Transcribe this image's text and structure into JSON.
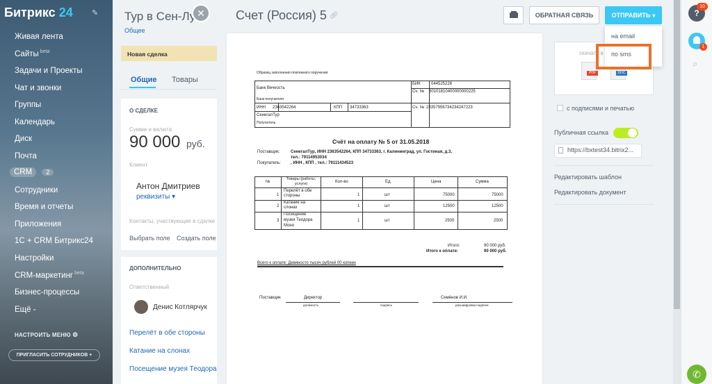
{
  "sidebar": {
    "logo_main": "Битрикс",
    "logo_num": "24",
    "items": [
      {
        "label": "Живая лента"
      },
      {
        "label": "Сайты",
        "badge": "beta"
      },
      {
        "label": "Задачи и Проекты"
      },
      {
        "label": "Чат и звонки"
      },
      {
        "label": "Группы"
      },
      {
        "label": "Календарь"
      },
      {
        "label": "Диск"
      },
      {
        "label": "Почта"
      },
      {
        "label": "CRM",
        "count": "2"
      },
      {
        "label": "Сотрудники"
      },
      {
        "label": "Время и отчеты"
      },
      {
        "label": "Приложения"
      },
      {
        "label": "1С + CRM Битрикс24"
      },
      {
        "label": "Настройки"
      },
      {
        "label": "CRM-маркетинг",
        "badge": "beta"
      },
      {
        "label": "Бизнес-процессы"
      },
      {
        "label": "Ещё -"
      }
    ],
    "menu_settings": "НАСТРОИТЬ МЕНЮ",
    "invite": "ПРИГЛАСИТЬ СОТРУДНИКОВ"
  },
  "deal": {
    "title": "Тур в Сен-Лу",
    "subtitle": "Общее",
    "stage": "Новая сделка",
    "tabs": [
      "Общие",
      "Товары"
    ],
    "section_about": "О СДЕЛКЕ",
    "amount_label": "Сумма и валюта",
    "amount": "90 000",
    "currency": "руб.",
    "client_label": "Клиент",
    "contact": "Антон Дмитриев",
    "requisites": "реквизиты",
    "contacts_note": "Контакты, участвующие в сделке",
    "select_field": "Выбрать поле",
    "create_field": "Создать поле",
    "section_more": "ДОПОЛНИТЕЛЬНО",
    "responsible_label": "Ответственный",
    "responsible": "Денис Котлярчук",
    "products": [
      "Перелёт в обе стороны",
      "Катание на слонах",
      "Посещение музея Теодора М"
    ]
  },
  "panel": {
    "title": "Счет (Россия) 5",
    "feedback": "ОБРАТНАЯ СВЯЗЬ",
    "send": "ОТПРАВИТЬ",
    "dropdown": [
      "на email",
      "по sms"
    ]
  },
  "document": {
    "sample": "Образец заполнения платежного поручения",
    "bank_name": "Банк Вечность",
    "bank_recipient": "Банк получателя",
    "bik_label": "БИК",
    "bik": "044525226",
    "account_label": "Сч. №",
    "account1": "30101810400000000225",
    "inn_label": "ИНН",
    "inn": "2363542264",
    "kpp_label": "КПП",
    "kpp": "34733363",
    "account2": "23357956734234247223",
    "company": "СенегалТур",
    "recipient": "Получатель",
    "heading": "Счёт на оплату № 5 от 31.05.2018",
    "supplier_label": "Поставщик:",
    "supplier_l1": "СенегалТур, ИНН 2363542264, КПП 34733363, г. Калининград, ул. Гостиная, д.3,",
    "supplier_l2": "тел.: 79114953034",
    "buyer_label": "Покупатель:",
    "buyer": ", ИНН , КПП , тел.: 79111434523",
    "table_headers": [
      "№",
      "Товары (работы, услуги)",
      "Кол-во",
      "Ед.",
      "Цена",
      "Сумма"
    ],
    "rows": [
      {
        "n": "1",
        "name_l1": "Перелёт в обе",
        "name_l2": "стороны",
        "name_l3": "",
        "qty": "1",
        "unit": "шт",
        "price": "75000",
        "sum": "75000"
      },
      {
        "n": "2",
        "name_l1": "Катание на",
        "name_l2": "слонах",
        "name_l3": "",
        "qty": "1",
        "unit": "шт",
        "price": "12500",
        "sum": "12500"
      },
      {
        "n": "3",
        "name_l1": "Посещение",
        "name_l2": "музея Теодора",
        "name_l3": "Моно",
        "qty": "1",
        "unit": "шт",
        "price": "2500",
        "sum": "2500"
      }
    ],
    "total_label": "Итого:",
    "total": "90 000 руб.",
    "total_pay_label": "Итого к оплате:",
    "total_pay": "90 000 руб.",
    "total_words": "Всего к оплате: Девяносто тысяч рублей 00 копеек",
    "sign_supplier": "Поставщик",
    "sign_position": "Директор",
    "sign_name": "Семёнов И.И.",
    "sign_pos_label": "должность",
    "sign_sig_label": "подпись",
    "sign_dec_label": "расшифровка подписи"
  },
  "right_column": {
    "download": "скачать в",
    "pdf": "PDF",
    "doc": "DOC",
    "signatures": "с подписями и печатью",
    "public_link": "Публичная ссылка",
    "url": "https://bxtest34.bitrix2...",
    "edit_template": "Редактировать шаблон",
    "edit_document": "Редактировать документ"
  },
  "rail": {
    "help_badge": "10",
    "bell_badge": "1"
  }
}
